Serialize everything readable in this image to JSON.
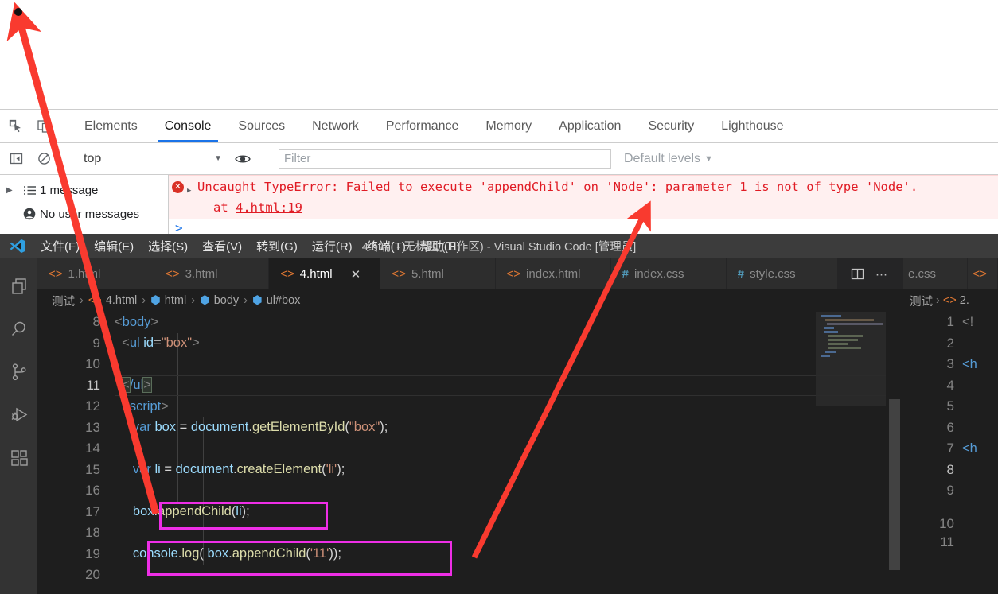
{
  "devtools": {
    "toolbar_icons": [
      "inspect-element-icon",
      "device-toolbar-icon"
    ],
    "tabs": [
      {
        "label": "Elements",
        "active": false
      },
      {
        "label": "Console",
        "active": true
      },
      {
        "label": "Sources",
        "active": false
      },
      {
        "label": "Network",
        "active": false
      },
      {
        "label": "Performance",
        "active": false
      },
      {
        "label": "Memory",
        "active": false
      },
      {
        "label": "Application",
        "active": false
      },
      {
        "label": "Security",
        "active": false
      },
      {
        "label": "Lighthouse",
        "active": false
      }
    ],
    "filterbar": {
      "context": "top",
      "filter_value": "",
      "filter_placeholder": "Filter",
      "levels": "Default levels",
      "caret": "▼"
    },
    "sidebar": {
      "message_count": "1 message",
      "user_messages": "No user messages"
    },
    "console": {
      "error_text": "Uncaught TypeError: Failed to execute 'appendChild' on 'Node': parameter 1 is not of type 'Node'.",
      "error_at_prefix": "at ",
      "error_source": "4.html:19",
      "prompt": ">"
    },
    "colors": {
      "error_red": "#e01b24",
      "error_bg": "#fff0f0",
      "accent_blue": "#1a73e8"
    }
  },
  "vscode": {
    "window_title": "4.html - 无标题 (工作区) - Visual Studio Code [管理员]",
    "menu": [
      "文件(F)",
      "编辑(E)",
      "选择(S)",
      "查看(V)",
      "转到(G)",
      "运行(R)",
      "终端(T)",
      "帮助(H)"
    ],
    "activitybar": [
      {
        "name": "explorer-icon"
      },
      {
        "name": "search-icon"
      },
      {
        "name": "source-control-icon"
      },
      {
        "name": "run-and-debug-icon"
      },
      {
        "name": "extensions-icon"
      }
    ],
    "tabs": [
      {
        "label": "1.html",
        "icon": "html-icon",
        "active": false
      },
      {
        "label": "3.html",
        "icon": "html-icon",
        "active": false
      },
      {
        "label": "4.html",
        "icon": "html-icon",
        "active": true,
        "close": "✕"
      },
      {
        "label": "5.html",
        "icon": "html-icon",
        "active": false
      },
      {
        "label": "index.html",
        "icon": "html-icon",
        "active": false
      },
      {
        "label": "index.css",
        "icon": "css-icon",
        "active": false
      },
      {
        "label": "style.css",
        "icon": "css-icon",
        "active": false
      }
    ],
    "tab_actions": [
      {
        "name": "split-editor-icon",
        "glyph": "▯"
      },
      {
        "name": "more-actions-icon",
        "glyph": "⋯"
      }
    ],
    "breadcrumbs": [
      "测试",
      "4.html",
      "html",
      "body",
      "ul#box"
    ],
    "editor": {
      "first_line": 8,
      "lines": [
        {
          "n": 8,
          "text": "<body>"
        },
        {
          "n": 9,
          "text": "    <ul id=\"box\">"
        },
        {
          "n": 10,
          "text": ""
        },
        {
          "n": 11,
          "text": "    </ul>"
        },
        {
          "n": 12,
          "text": "    <script>"
        },
        {
          "n": 13,
          "text": "        var box = document.getElementById(\"box\");"
        },
        {
          "n": 14,
          "text": ""
        },
        {
          "n": 15,
          "text": "        var li = document.createElement('li');"
        },
        {
          "n": 16,
          "text": ""
        },
        {
          "n": 17,
          "text": "        box.appendChild(li);"
        },
        {
          "n": 18,
          "text": ""
        },
        {
          "n": 19,
          "text": "        console.log( box.appendChild('11'));"
        },
        {
          "n": 20,
          "text": ""
        }
      ],
      "cursor_line": 11
    },
    "side_editor": {
      "breadcrumbs": [
        "测试",
        "2."
      ],
      "partial_tab": "e.css",
      "lines": [
        {
          "n": 1,
          "text": "<!"
        },
        {
          "n": 2,
          "text": ""
        },
        {
          "n": 3,
          "text": "<h"
        },
        {
          "n": 4,
          "text": ""
        },
        {
          "n": 5,
          "text": ""
        },
        {
          "n": 6,
          "text": ""
        },
        {
          "n": 7,
          "text": "<h"
        },
        {
          "n": 8,
          "text": ""
        },
        {
          "n": 9,
          "text": ""
        },
        {
          "n": 10,
          "text": ""
        },
        {
          "n": 11,
          "text": ""
        }
      ],
      "cursor_line": 8
    }
  },
  "annotations": {
    "highlight_color": "#ee2ee6",
    "arrow_color": "#f93a2f",
    "boxes": [
      {
        "name": "highlight-appendchild-li",
        "target": "box.appendChild(li);"
      },
      {
        "name": "highlight-consolelog-appendchild",
        "target": "console.log( box.appendChild('11'));"
      }
    ],
    "arrows": [
      {
        "name": "arrow-to-top-left",
        "from": "code line 17 area",
        "to": "top-left dot"
      },
      {
        "name": "arrow-to-console-error",
        "from": "code line 19 area",
        "to": "console error message"
      }
    ],
    "dot": {
      "name": "cursor-dot"
    }
  }
}
